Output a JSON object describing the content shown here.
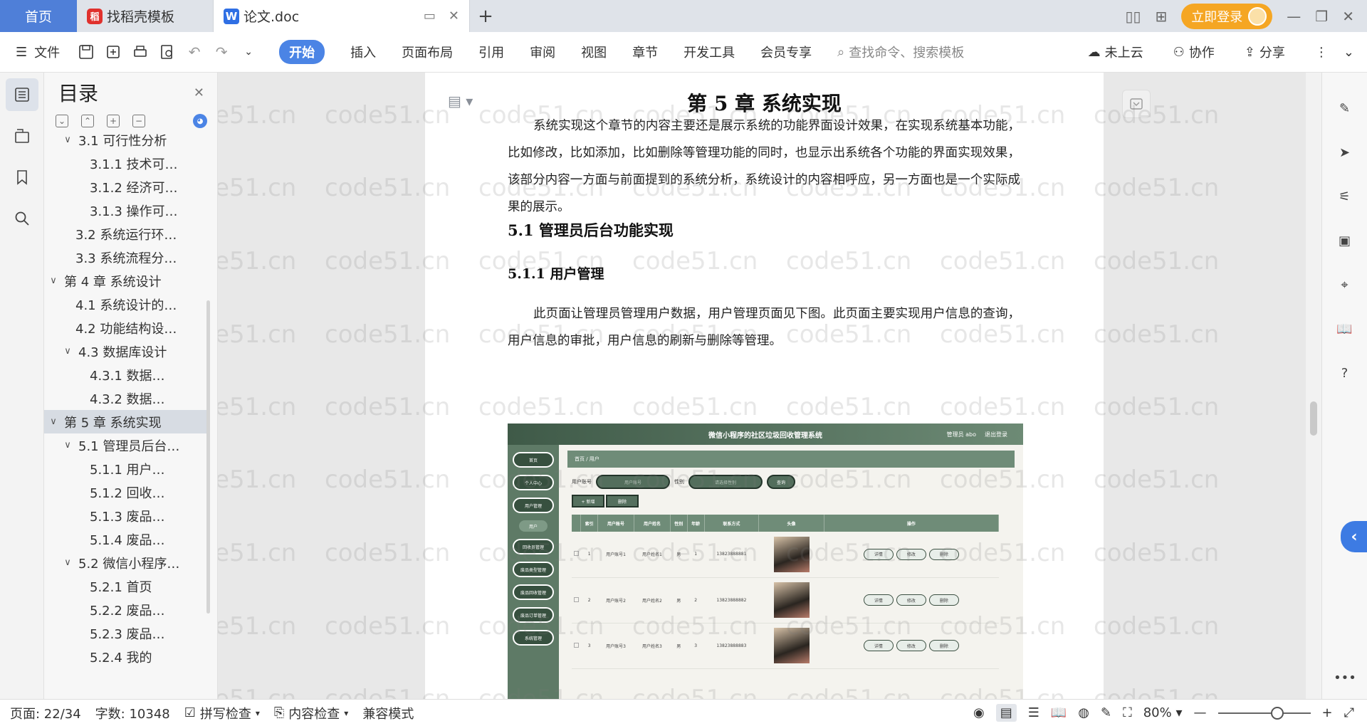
{
  "tabs": {
    "home": "首页",
    "template": "找稻壳模板",
    "doc": "论文.doc",
    "login": "立即登录"
  },
  "menubar": {
    "file": "文件",
    "items": [
      "开始",
      "插入",
      "页面布局",
      "引用",
      "审阅",
      "视图",
      "章节",
      "开发工具",
      "会员专享"
    ],
    "active": "开始",
    "search_placeholder": "查找命令、搜索模板",
    "cloud": "未上云",
    "collab": "协作",
    "share": "分享"
  },
  "toc": {
    "title": "目录",
    "items": [
      {
        "label": "3.1 可行性分析",
        "level": 2,
        "arrow": "∨"
      },
      {
        "label": "3.1.1 技术可…",
        "level": 3,
        "arrow": ""
      },
      {
        "label": "3.1.2 经济可…",
        "level": 3,
        "arrow": ""
      },
      {
        "label": "3.1.3 操作可…",
        "level": 3,
        "arrow": ""
      },
      {
        "label": "3.2 系统运行环…",
        "level": 2,
        "arrow": ""
      },
      {
        "label": "3.3 系统流程分…",
        "level": 2,
        "arrow": ""
      },
      {
        "label": "第 4 章  系统设计",
        "level": 1,
        "arrow": "∨"
      },
      {
        "label": "4.1  系统设计的…",
        "level": 2,
        "arrow": ""
      },
      {
        "label": "4.2  功能结构设…",
        "level": 2,
        "arrow": ""
      },
      {
        "label": "4.3  数据库设计",
        "level": 2,
        "arrow": "∨"
      },
      {
        "label": "4.3.1  数据…",
        "level": 3,
        "arrow": ""
      },
      {
        "label": "4.3.2  数据…",
        "level": 3,
        "arrow": ""
      },
      {
        "label": "第 5 章  系统实现",
        "level": 1,
        "arrow": "∨",
        "selected": true
      },
      {
        "label": "5.1 管理员后台…",
        "level": 2,
        "arrow": "∨"
      },
      {
        "label": "5.1.1  用户…",
        "level": 3,
        "arrow": ""
      },
      {
        "label": "5.1.2  回收…",
        "level": 3,
        "arrow": ""
      },
      {
        "label": "5.1.3  废品…",
        "level": 3,
        "arrow": ""
      },
      {
        "label": "5.1.4  废品…",
        "level": 3,
        "arrow": ""
      },
      {
        "label": "5.2  微信小程序…",
        "level": 2,
        "arrow": "∨"
      },
      {
        "label": "5.2.1  首页",
        "level": 3,
        "arrow": ""
      },
      {
        "label": "5.2.2  废品…",
        "level": 3,
        "arrow": ""
      },
      {
        "label": "5.2.3  废品…",
        "level": 3,
        "arrow": ""
      },
      {
        "label": "5.2.4  我的",
        "level": 3,
        "arrow": ""
      }
    ]
  },
  "document": {
    "chapter_title": "第 5 章  系统实现",
    "intro": "系统实现这个章节的内容主要还是展示系统的功能界面设计效果，在实现系统基本功能，比如修改，比如添加，比如删除等管理功能的同时，也显示出系统各个功能的界面实现效果，该部分内容一方面与前面提到的系统分析，系统设计的内容相呼应，另一方面也是一个实际成果的展示。",
    "section": "5.1 管理员后台功能实现",
    "subsection": "5.1.1  用户管理",
    "para2": "此页面让管理员管理用户数据，用户管理页面见下图。此页面主要实现用户信息的查询，用户信息的审批，用户信息的刷新与删除等管理。"
  },
  "screenshot": {
    "title": "微信小程序的社区垃圾回收管理系统",
    "user": "管理员 abo",
    "logout": "退出登录",
    "side": [
      "首页",
      "个人中心",
      "用户管理",
      "用户",
      "回收员管理",
      "废品类型管理",
      "废品回收管理",
      "废品订单管理",
      "系统管理"
    ],
    "crumb": "首页 / 用户",
    "filter_account_label": "用户账号",
    "filter_account_placeholder": "用户账号",
    "filter_gender_label": "性别",
    "filter_gender_placeholder": "请选择性别",
    "query": "查询",
    "add": "+ 新增",
    "delete": "删除",
    "columns": [
      "",
      "索引",
      "用户账号",
      "用户姓名",
      "性别",
      "年龄",
      "联系方式",
      "头像",
      "操作"
    ],
    "rows": [
      {
        "idx": "1",
        "account": "用户账号1",
        "name": "用户姓名1",
        "gender": "男",
        "age": "1",
        "phone": "13823888881"
      },
      {
        "idx": "2",
        "account": "用户账号2",
        "name": "用户姓名2",
        "gender": "男",
        "age": "2",
        "phone": "13823888882"
      },
      {
        "idx": "3",
        "account": "用户账号3",
        "name": "用户姓名3",
        "gender": "男",
        "age": "3",
        "phone": "13823888883"
      }
    ],
    "ops": [
      "详情",
      "修改",
      "删除"
    ]
  },
  "watermark": "code51.cn",
  "status": {
    "page": "页面: 22/34",
    "words": "字数: 10348",
    "spell": "拼写检查",
    "content": "内容检查",
    "compat": "兼容模式",
    "zoom": "80%"
  }
}
